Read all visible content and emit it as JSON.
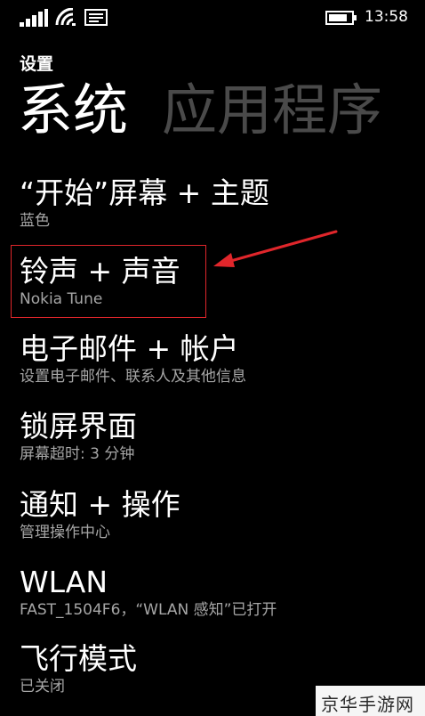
{
  "status_bar": {
    "time": "13:58",
    "icons": [
      "signal-icon",
      "wifi-icon",
      "message-icon",
      "battery-icon"
    ]
  },
  "app_title": "设置",
  "pivot": {
    "active": "系统",
    "next": "应用程序"
  },
  "items": [
    {
      "title": "“开始”屏幕 + 主题",
      "subtitle": "蓝色"
    },
    {
      "title": "铃声 + 声音",
      "subtitle": "Nokia Tune"
    },
    {
      "title": "电子邮件 + 帐户",
      "subtitle": "设置电子邮件、联系人及其他信息"
    },
    {
      "title": "锁屏界面",
      "subtitle": "屏幕超时: 3 分钟"
    },
    {
      "title": "通知 + 操作",
      "subtitle": "管理操作中心"
    },
    {
      "title": "WLAN",
      "subtitle": "FAST_1504F6，“WLAN 感知”已打开"
    },
    {
      "title": "飞行模式",
      "subtitle": "已关闭"
    }
  ],
  "annotation_color": "#e0262b",
  "watermark": "京华手游网"
}
